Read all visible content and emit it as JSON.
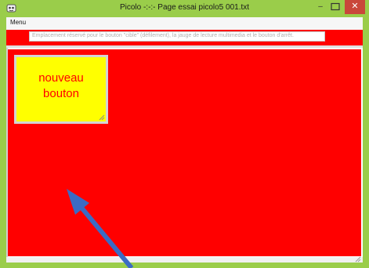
{
  "window": {
    "title": "Picolo -:-:- Page essai picolo5 001.txt",
    "min_glyph": "–",
    "close_glyph": "✕"
  },
  "menubar": {
    "menu_label": "Menu"
  },
  "toolbar": {
    "placeholder_text": "Emplacement réservé pour le bouton \"cible\" (défilement), la jauge de lecture multimedia et le bouton d'arrêt."
  },
  "canvas": {
    "button_label_line1": "nouveau",
    "button_label_line2": "bouton"
  },
  "colors": {
    "frame": "#9acd4a",
    "canvas": "#ff0000",
    "button_bg": "#ffff00",
    "button_text": "#ff0000",
    "arrow": "#3b6bc4"
  },
  "icons": {
    "app_icon": "picolo-app-icon",
    "minimize": "minimize-icon",
    "maximize": "maximize-icon",
    "close": "close-icon",
    "resize_grip": "resize-grip-icon",
    "annotation_arrow": "arrow-annotation"
  }
}
